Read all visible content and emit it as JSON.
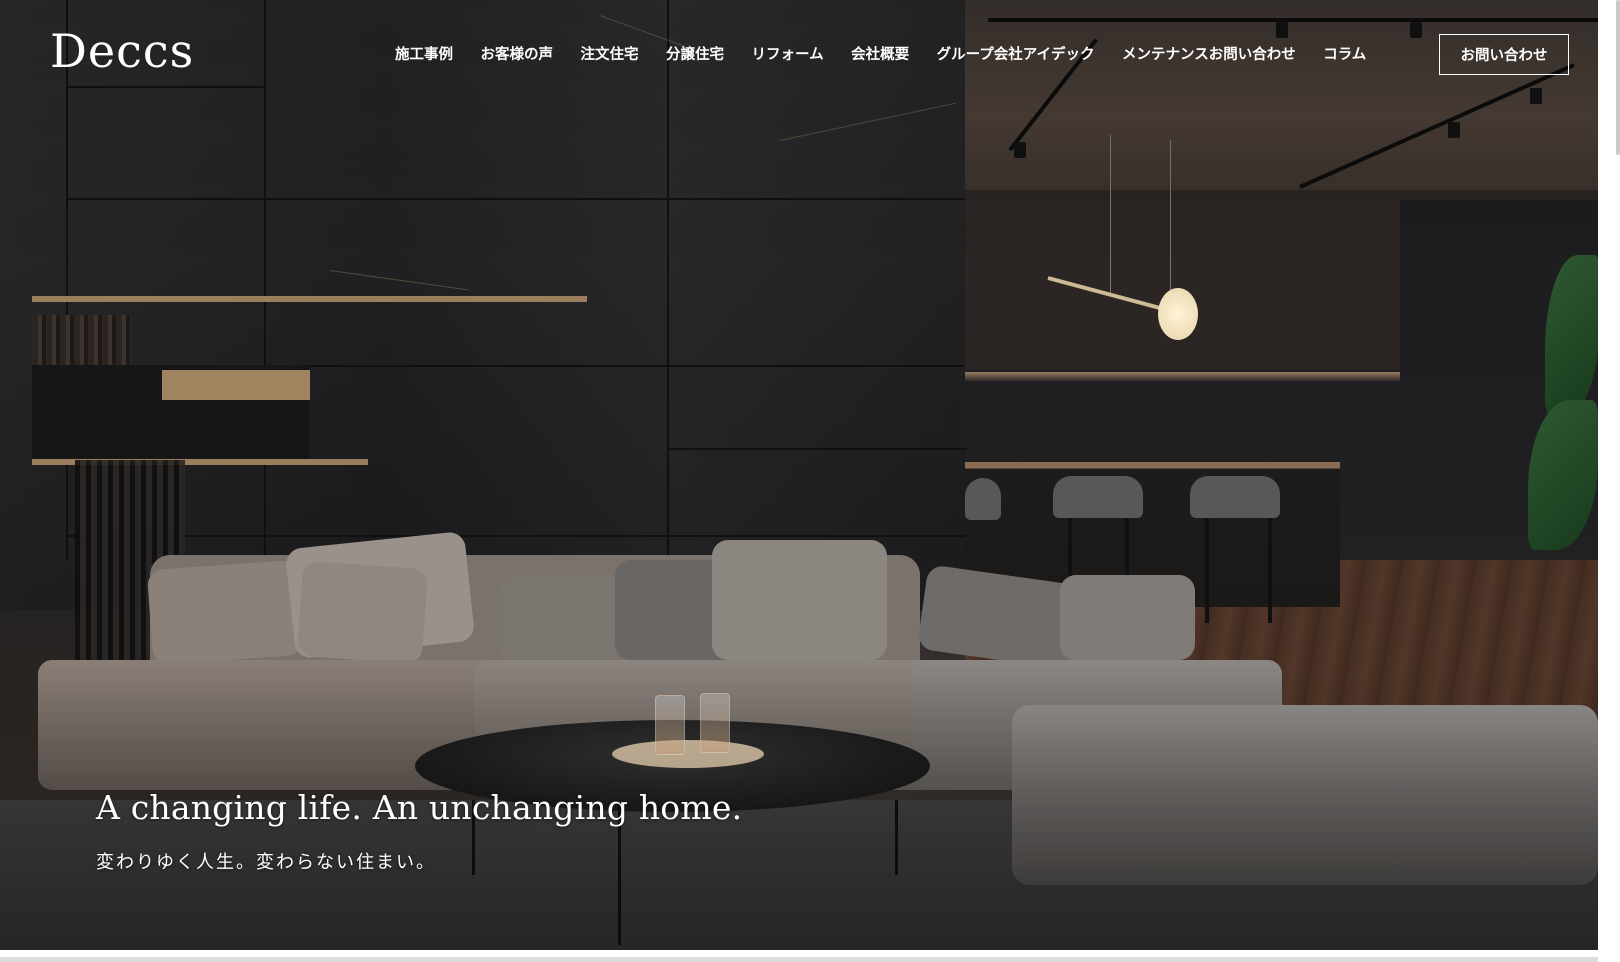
{
  "brand": {
    "logo_text": "Deccs"
  },
  "nav": {
    "items": [
      {
        "label": "施工事例"
      },
      {
        "label": "お客様の声"
      },
      {
        "label": "注文住宅"
      },
      {
        "label": "分譲住宅"
      },
      {
        "label": "リフォーム"
      },
      {
        "label": "会社概要"
      },
      {
        "label": "グループ会社アイデック"
      },
      {
        "label": "メンテナンスお問い合わせ"
      },
      {
        "label": "コラム"
      }
    ],
    "contact_label": "お問い合わせ"
  },
  "hero": {
    "headline": "A changing life. An unchanging home.",
    "subheadline": "変わりゆく人生。変わらない住まい。",
    "image_subject": "living-room-photo"
  },
  "colors": {
    "text": "#ffffff",
    "slate_wall": "#1f1f21",
    "wood_accent": "#9a7e5e"
  }
}
